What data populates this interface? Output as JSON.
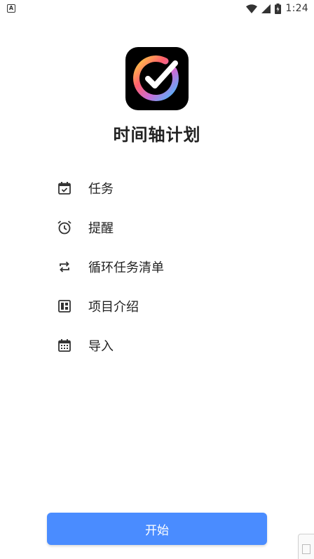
{
  "status_bar": {
    "notification_glyph": "A",
    "time": "1:24",
    "battery_glyph": "ϟ"
  },
  "app": {
    "title": "时间轴计划"
  },
  "features": [
    {
      "label": "任务",
      "icon": "calendar-check-icon"
    },
    {
      "label": "提醒",
      "icon": "alarm-clock-icon"
    },
    {
      "label": "循环任务清单",
      "icon": "repeat-icon"
    },
    {
      "label": "项目介绍",
      "icon": "dashboard-icon"
    },
    {
      "label": "导入",
      "icon": "calendar-grid-icon"
    }
  ],
  "start_button": {
    "label": "开始"
  },
  "colors": {
    "accent": "#4a8cff",
    "text": "#222222",
    "logo_bg": "#000000"
  }
}
